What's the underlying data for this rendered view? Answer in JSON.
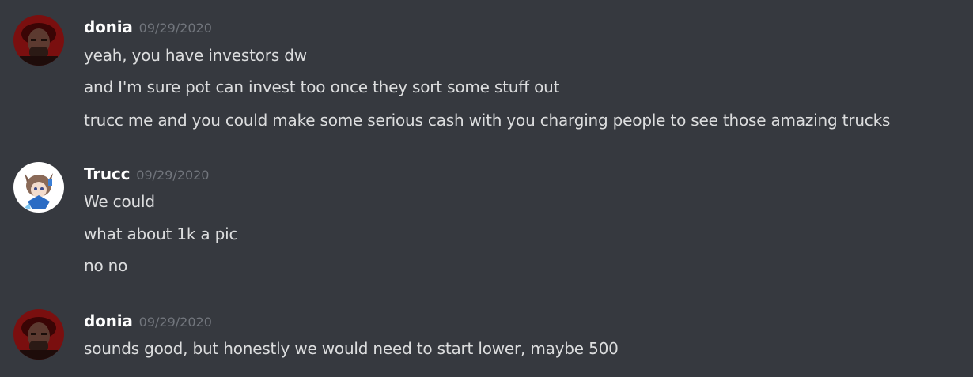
{
  "messages": [
    {
      "username": "donia",
      "timestamp": "09/29/2020",
      "avatar_icon": "dark-red-person-avatar",
      "lines": [
        "yeah, you have investors dw",
        "and I'm sure pot can invest too once they sort some stuff out",
        "trucc me and you could make some serious cash with you charging people to see those amazing trucks"
      ]
    },
    {
      "username": "Trucc",
      "timestamp": "09/29/2020",
      "avatar_icon": "anime-character-avatar",
      "lines": [
        "We could",
        "what about 1k a pic",
        "no no"
      ]
    },
    {
      "username": "donia",
      "timestamp": "09/29/2020",
      "avatar_icon": "dark-red-person-avatar",
      "lines": [
        "sounds good, but honestly we would need to start lower, maybe 500"
      ]
    }
  ],
  "colors": {
    "background": "#36393f",
    "username": "#ffffff",
    "timestamp": "#72767d",
    "message_text": "#dcddde"
  }
}
